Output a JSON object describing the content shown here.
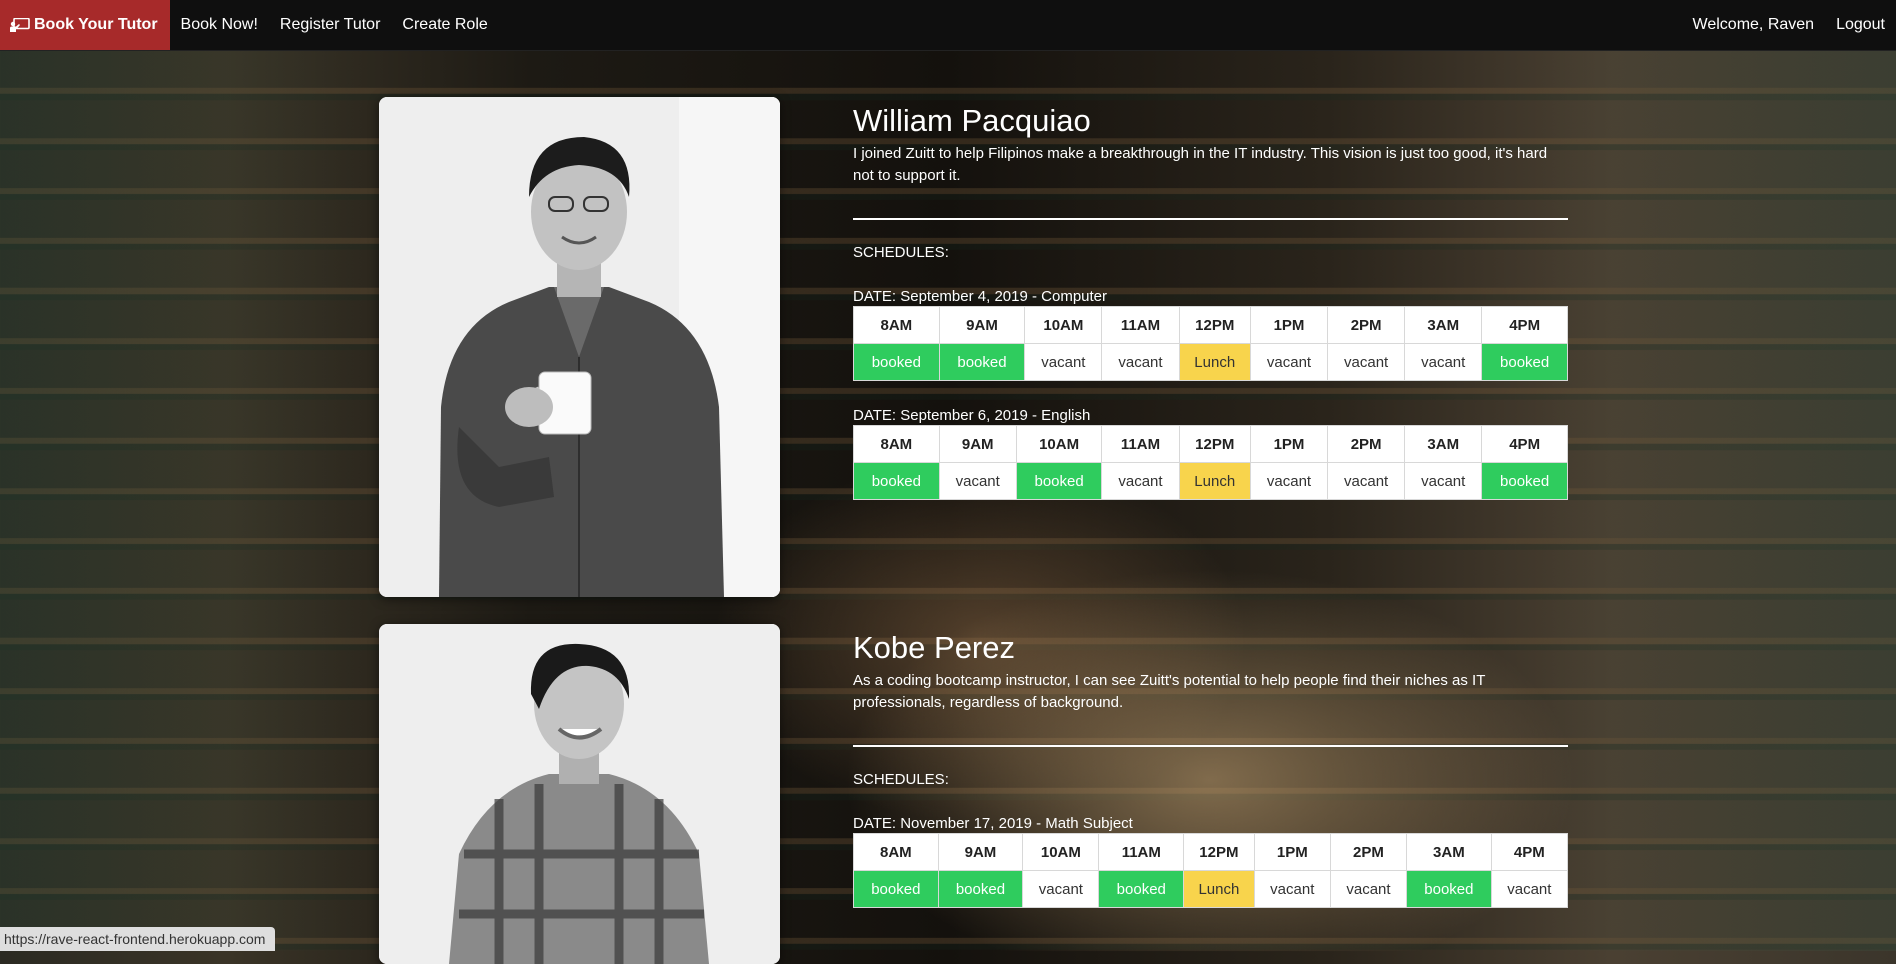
{
  "nav": {
    "brand": "Book Your Tutor",
    "links": [
      "Book Now!",
      "Register Tutor",
      "Create Role"
    ],
    "welcome": "Welcome, Raven",
    "logout": "Logout"
  },
  "status_url": "https://rave-react-frontend.herokuapp.com",
  "schedules_label": "SCHEDULES:",
  "colors": {
    "booked": "#2fcc5e",
    "lunch": "#f8d44c",
    "brand": "#a72a2a"
  },
  "tutors": [
    {
      "name": "William Pacquiao",
      "bio": "I joined Zuitt to help Filipinos make a breakthrough in the IT industry. This vision is just too good, it's hard not to support it.",
      "schedules": [
        {
          "date": "DATE: September 4, 2019 - Computer",
          "times": [
            "8AM",
            "9AM",
            "10AM",
            "11AM",
            "12PM",
            "1PM",
            "2PM",
            "3AM",
            "4PM"
          ],
          "status": [
            "booked",
            "booked",
            "vacant",
            "vacant",
            "Lunch",
            "vacant",
            "vacant",
            "vacant",
            "booked"
          ]
        },
        {
          "date": "DATE: September 6, 2019 - English",
          "times": [
            "8AM",
            "9AM",
            "10AM",
            "11AM",
            "12PM",
            "1PM",
            "2PM",
            "3AM",
            "4PM"
          ],
          "status": [
            "booked",
            "vacant",
            "booked",
            "vacant",
            "Lunch",
            "vacant",
            "vacant",
            "vacant",
            "booked"
          ]
        }
      ]
    },
    {
      "name": "Kobe Perez",
      "bio": "As a coding bootcamp instructor, I can see Zuitt's potential to help people find their niches as IT professionals, regardless of background.",
      "schedules": [
        {
          "date": "DATE: November 17, 2019 - Math Subject",
          "times": [
            "8AM",
            "9AM",
            "10AM",
            "11AM",
            "12PM",
            "1PM",
            "2PM",
            "3AM",
            "4PM"
          ],
          "status": [
            "booked",
            "booked",
            "vacant",
            "booked",
            "Lunch",
            "vacant",
            "vacant",
            "booked",
            "vacant"
          ]
        }
      ]
    }
  ]
}
